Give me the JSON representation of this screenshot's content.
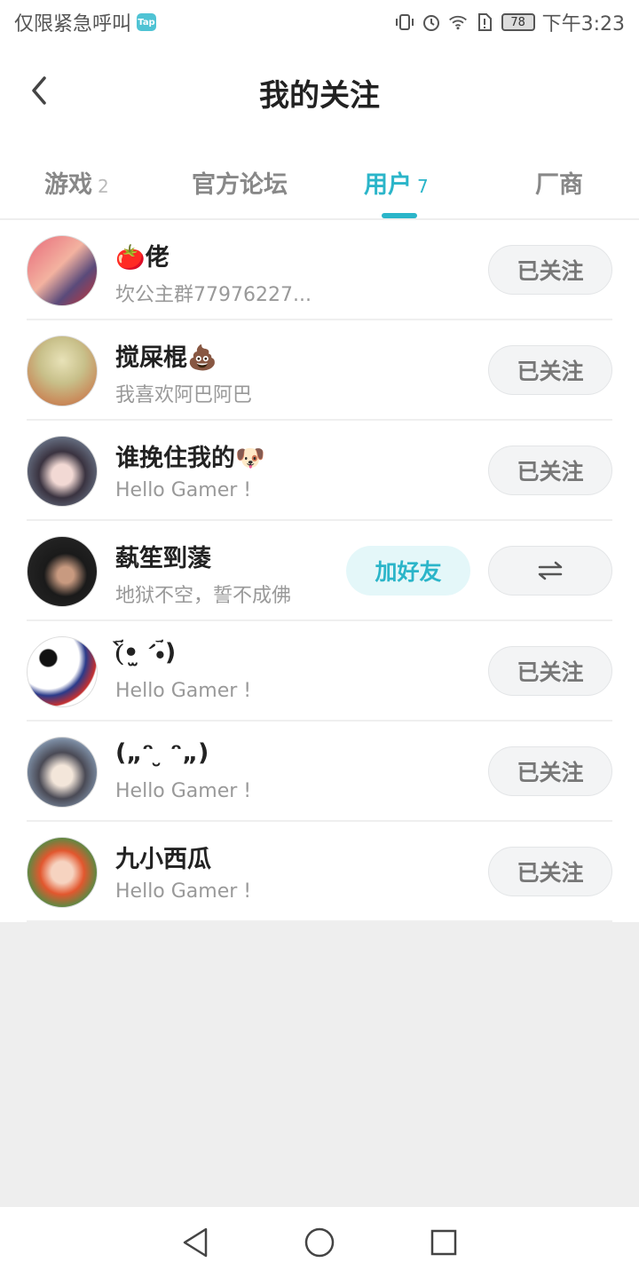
{
  "status_bar": {
    "carrier_text": "仅限紧急呼叫",
    "tap_badge": "Tap",
    "battery": "78",
    "time": "下午3:23",
    "icons": [
      "vibrate-icon",
      "alarm-icon",
      "wifi-icon",
      "sim-alert-icon",
      "battery-icon"
    ]
  },
  "header": {
    "title": "我的关注",
    "back_icon": "chevron-left-icon"
  },
  "tabs": [
    {
      "label": "游戏",
      "count": "2"
    },
    {
      "label": "官方论坛",
      "count": ""
    },
    {
      "label": "用户",
      "count": "7"
    },
    {
      "label": "厂商",
      "count": ""
    }
  ],
  "users": [
    {
      "name": "🍅佬",
      "sub": "坎公主群77976227...",
      "action": "已关注"
    },
    {
      "name": "搅屎棍💩",
      "sub": "我喜欢阿巴阿巴",
      "action": "已关注"
    },
    {
      "name": "谁挽住我的🐶",
      "sub": "Hello Gamer !",
      "action": "已关注"
    },
    {
      "name": "蓺笙剄蔆",
      "sub": "地狱不空，誓不成佛",
      "add_friend": "加好友",
      "action_icon": "swap-arrows-icon"
    },
    {
      "name": "(ؔ•̀ ̫ •́ؔ)",
      "sub": "Hello Gamer !",
      "action": "已关注"
    },
    {
      "name": "(„ᵔ ̮ ᵔ„)",
      "sub": "Hello Gamer !",
      "action": "已关注"
    },
    {
      "name": "九小西瓜",
      "sub": "Hello Gamer !",
      "action": "已关注"
    }
  ],
  "colors": {
    "accent": "#2bb5c9",
    "background": "#eeeeee"
  },
  "nav": [
    "back-triangle-icon",
    "home-circle-icon",
    "recents-square-icon"
  ]
}
